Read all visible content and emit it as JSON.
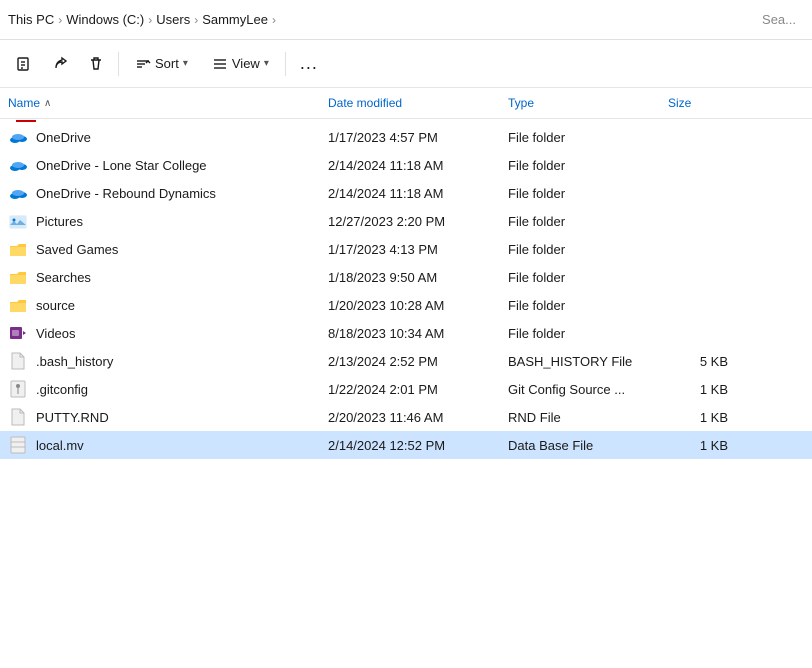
{
  "breadcrumb": {
    "items": [
      {
        "label": "This PC"
      },
      {
        "label": "Windows (C:)"
      },
      {
        "label": "Users"
      },
      {
        "label": "SammyLee"
      }
    ],
    "search_placeholder": "Sea..."
  },
  "toolbar": {
    "rename_label": "",
    "share_label": "",
    "delete_label": "",
    "sort_label": "Sort",
    "view_label": "View",
    "more_label": "..."
  },
  "file_list": {
    "columns": [
      "Name",
      "Date modified",
      "Type",
      "Size"
    ],
    "sort_col": "Name",
    "rows": [
      {
        "name": "OneDrive",
        "date": "1/17/2023 4:57 PM",
        "type": "File folder",
        "size": "",
        "icon": "onedrive",
        "selected": false
      },
      {
        "name": "OneDrive - Lone Star College",
        "date": "2/14/2024 11:18 AM",
        "type": "File folder",
        "size": "",
        "icon": "onedrive",
        "selected": false
      },
      {
        "name": "OneDrive - Rebound Dynamics",
        "date": "2/14/2024 11:18 AM",
        "type": "File folder",
        "size": "",
        "icon": "onedrive",
        "selected": false
      },
      {
        "name": "Pictures",
        "date": "12/27/2023 2:20 PM",
        "type": "File folder",
        "size": "",
        "icon": "pictures",
        "selected": false
      },
      {
        "name": "Saved Games",
        "date": "1/17/2023 4:13 PM",
        "type": "File folder",
        "size": "",
        "icon": "folder",
        "selected": false
      },
      {
        "name": "Searches",
        "date": "1/18/2023 9:50 AM",
        "type": "File folder",
        "size": "",
        "icon": "folder",
        "selected": false
      },
      {
        "name": "source",
        "date": "1/20/2023 10:28 AM",
        "type": "File folder",
        "size": "",
        "icon": "folder",
        "selected": false
      },
      {
        "name": "Videos",
        "date": "8/18/2023 10:34 AM",
        "type": "File folder",
        "size": "",
        "icon": "videos",
        "selected": false
      },
      {
        "name": ".bash_history",
        "date": "2/13/2024 2:52 PM",
        "type": "BASH_HISTORY File",
        "size": "5 KB",
        "icon": "file",
        "selected": false
      },
      {
        "name": ".gitconfig",
        "date": "1/22/2024 2:01 PM",
        "type": "Git Config Source ...",
        "size": "1 KB",
        "icon": "git",
        "selected": false
      },
      {
        "name": "PUTTY.RND",
        "date": "2/20/2023 11:46 AM",
        "type": "RND File",
        "size": "1 KB",
        "icon": "file",
        "selected": false
      },
      {
        "name": "local.mv",
        "date": "2/14/2024 12:52 PM",
        "type": "Data Base File",
        "size": "1 KB",
        "icon": "db",
        "selected": true
      }
    ]
  }
}
